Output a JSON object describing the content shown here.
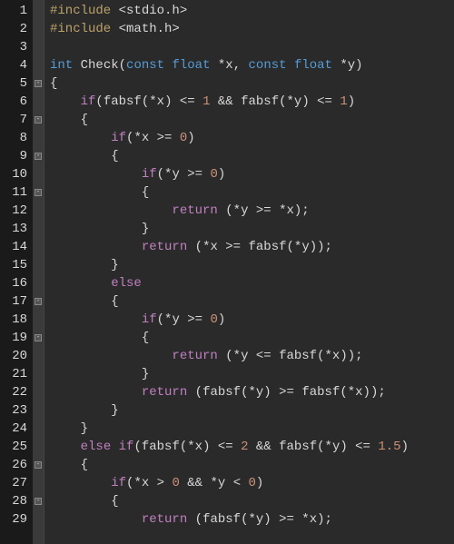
{
  "lines": [
    {
      "num": "1",
      "fold": false,
      "tokens": [
        [
          "pre",
          "#include"
        ],
        [
          "op",
          " "
        ],
        [
          "inc",
          "<stdio.h>"
        ]
      ]
    },
    {
      "num": "2",
      "fold": false,
      "tokens": [
        [
          "pre",
          "#include"
        ],
        [
          "op",
          " "
        ],
        [
          "inc",
          "<math.h>"
        ]
      ]
    },
    {
      "num": "3",
      "fold": false,
      "tokens": []
    },
    {
      "num": "4",
      "fold": false,
      "tokens": [
        [
          "kw",
          "int"
        ],
        [
          "op",
          " "
        ],
        [
          "fn",
          "Check"
        ],
        [
          "punc",
          "("
        ],
        [
          "kw",
          "const"
        ],
        [
          "op",
          " "
        ],
        [
          "kw",
          "float"
        ],
        [
          "op",
          " *"
        ],
        [
          "id",
          "x"
        ],
        [
          "punc",
          ", "
        ],
        [
          "kw",
          "const"
        ],
        [
          "op",
          " "
        ],
        [
          "kw",
          "float"
        ],
        [
          "op",
          " *"
        ],
        [
          "id",
          "y"
        ],
        [
          "punc",
          ")"
        ]
      ]
    },
    {
      "num": "5",
      "fold": true,
      "tokens": [
        [
          "punc",
          "{"
        ]
      ]
    },
    {
      "num": "6",
      "fold": false,
      "tokens": [
        [
          "op",
          "    "
        ],
        [
          "ctrl",
          "if"
        ],
        [
          "punc",
          "("
        ],
        [
          "fn",
          "fabsf"
        ],
        [
          "punc",
          "("
        ],
        [
          "op",
          "*"
        ],
        [
          "id",
          "x"
        ],
        [
          "punc",
          ")"
        ],
        [
          "op",
          " <= "
        ],
        [
          "num",
          "1"
        ],
        [
          "op",
          " && "
        ],
        [
          "fn",
          "fabsf"
        ],
        [
          "punc",
          "("
        ],
        [
          "op",
          "*"
        ],
        [
          "id",
          "y"
        ],
        [
          "punc",
          ")"
        ],
        [
          "op",
          " <= "
        ],
        [
          "num",
          "1"
        ],
        [
          "punc",
          ")"
        ]
      ]
    },
    {
      "num": "7",
      "fold": true,
      "tokens": [
        [
          "op",
          "    "
        ],
        [
          "punc",
          "{"
        ]
      ]
    },
    {
      "num": "8",
      "fold": false,
      "tokens": [
        [
          "op",
          "        "
        ],
        [
          "ctrl",
          "if"
        ],
        [
          "punc",
          "("
        ],
        [
          "op",
          "*"
        ],
        [
          "id",
          "x"
        ],
        [
          "op",
          " >= "
        ],
        [
          "num",
          "0"
        ],
        [
          "punc",
          ")"
        ]
      ]
    },
    {
      "num": "9",
      "fold": true,
      "tokens": [
        [
          "op",
          "        "
        ],
        [
          "punc",
          "{"
        ]
      ]
    },
    {
      "num": "10",
      "fold": false,
      "tokens": [
        [
          "op",
          "            "
        ],
        [
          "ctrl",
          "if"
        ],
        [
          "punc",
          "("
        ],
        [
          "op",
          "*"
        ],
        [
          "id",
          "y"
        ],
        [
          "op",
          " >= "
        ],
        [
          "num",
          "0"
        ],
        [
          "punc",
          ")"
        ]
      ]
    },
    {
      "num": "11",
      "fold": true,
      "tokens": [
        [
          "op",
          "            "
        ],
        [
          "punc",
          "{"
        ]
      ]
    },
    {
      "num": "12",
      "fold": false,
      "tokens": [
        [
          "op",
          "                "
        ],
        [
          "ctrl",
          "return"
        ],
        [
          "op",
          " "
        ],
        [
          "punc",
          "("
        ],
        [
          "op",
          "*"
        ],
        [
          "id",
          "y"
        ],
        [
          "op",
          " >= *"
        ],
        [
          "id",
          "x"
        ],
        [
          "punc",
          ");"
        ]
      ]
    },
    {
      "num": "13",
      "fold": false,
      "tokens": [
        [
          "op",
          "            "
        ],
        [
          "punc",
          "}"
        ]
      ]
    },
    {
      "num": "14",
      "fold": false,
      "tokens": [
        [
          "op",
          "            "
        ],
        [
          "ctrl",
          "return"
        ],
        [
          "op",
          " "
        ],
        [
          "punc",
          "("
        ],
        [
          "op",
          "*"
        ],
        [
          "id",
          "x"
        ],
        [
          "op",
          " >= "
        ],
        [
          "fn",
          "fabsf"
        ],
        [
          "punc",
          "("
        ],
        [
          "op",
          "*"
        ],
        [
          "id",
          "y"
        ],
        [
          "punc",
          "));"
        ]
      ]
    },
    {
      "num": "15",
      "fold": false,
      "tokens": [
        [
          "op",
          "        "
        ],
        [
          "punc",
          "}"
        ]
      ]
    },
    {
      "num": "16",
      "fold": false,
      "tokens": [
        [
          "op",
          "        "
        ],
        [
          "ctrl",
          "else"
        ]
      ]
    },
    {
      "num": "17",
      "fold": true,
      "tokens": [
        [
          "op",
          "        "
        ],
        [
          "punc",
          "{"
        ]
      ]
    },
    {
      "num": "18",
      "fold": false,
      "tokens": [
        [
          "op",
          "            "
        ],
        [
          "ctrl",
          "if"
        ],
        [
          "punc",
          "("
        ],
        [
          "op",
          "*"
        ],
        [
          "id",
          "y"
        ],
        [
          "op",
          " >= "
        ],
        [
          "num",
          "0"
        ],
        [
          "punc",
          ")"
        ]
      ]
    },
    {
      "num": "19",
      "fold": true,
      "tokens": [
        [
          "op",
          "            "
        ],
        [
          "punc",
          "{"
        ]
      ]
    },
    {
      "num": "20",
      "fold": false,
      "tokens": [
        [
          "op",
          "                "
        ],
        [
          "ctrl",
          "return"
        ],
        [
          "op",
          " "
        ],
        [
          "punc",
          "("
        ],
        [
          "op",
          "*"
        ],
        [
          "id",
          "y"
        ],
        [
          "op",
          " <= "
        ],
        [
          "fn",
          "fabsf"
        ],
        [
          "punc",
          "("
        ],
        [
          "op",
          "*"
        ],
        [
          "id",
          "x"
        ],
        [
          "punc",
          "));"
        ]
      ]
    },
    {
      "num": "21",
      "fold": false,
      "tokens": [
        [
          "op",
          "            "
        ],
        [
          "punc",
          "}"
        ]
      ]
    },
    {
      "num": "22",
      "fold": false,
      "tokens": [
        [
          "op",
          "            "
        ],
        [
          "ctrl",
          "return"
        ],
        [
          "op",
          " "
        ],
        [
          "punc",
          "("
        ],
        [
          "fn",
          "fabsf"
        ],
        [
          "punc",
          "("
        ],
        [
          "op",
          "*"
        ],
        [
          "id",
          "y"
        ],
        [
          "punc",
          ")"
        ],
        [
          "op",
          " >= "
        ],
        [
          "fn",
          "fabsf"
        ],
        [
          "punc",
          "("
        ],
        [
          "op",
          "*"
        ],
        [
          "id",
          "x"
        ],
        [
          "punc",
          "));"
        ]
      ]
    },
    {
      "num": "23",
      "fold": false,
      "tokens": [
        [
          "op",
          "        "
        ],
        [
          "punc",
          "}"
        ]
      ]
    },
    {
      "num": "24",
      "fold": false,
      "tokens": [
        [
          "op",
          "    "
        ],
        [
          "punc",
          "}"
        ]
      ]
    },
    {
      "num": "25",
      "fold": false,
      "tokens": [
        [
          "op",
          "    "
        ],
        [
          "ctrl",
          "else"
        ],
        [
          "op",
          " "
        ],
        [
          "ctrl",
          "if"
        ],
        [
          "punc",
          "("
        ],
        [
          "fn",
          "fabsf"
        ],
        [
          "punc",
          "("
        ],
        [
          "op",
          "*"
        ],
        [
          "id",
          "x"
        ],
        [
          "punc",
          ")"
        ],
        [
          "op",
          " <= "
        ],
        [
          "num",
          "2"
        ],
        [
          "op",
          " && "
        ],
        [
          "fn",
          "fabsf"
        ],
        [
          "punc",
          "("
        ],
        [
          "op",
          "*"
        ],
        [
          "id",
          "y"
        ],
        [
          "punc",
          ")"
        ],
        [
          "op",
          " <= "
        ],
        [
          "num",
          "1.5"
        ],
        [
          "punc",
          ")"
        ]
      ]
    },
    {
      "num": "26",
      "fold": true,
      "tokens": [
        [
          "op",
          "    "
        ],
        [
          "punc",
          "{"
        ]
      ]
    },
    {
      "num": "27",
      "fold": false,
      "tokens": [
        [
          "op",
          "        "
        ],
        [
          "ctrl",
          "if"
        ],
        [
          "punc",
          "("
        ],
        [
          "op",
          "*"
        ],
        [
          "id",
          "x"
        ],
        [
          "op",
          " > "
        ],
        [
          "num",
          "0"
        ],
        [
          "op",
          " && *"
        ],
        [
          "id",
          "y"
        ],
        [
          "op",
          " < "
        ],
        [
          "num",
          "0"
        ],
        [
          "punc",
          ")"
        ]
      ]
    },
    {
      "num": "28",
      "fold": true,
      "tokens": [
        [
          "op",
          "        "
        ],
        [
          "punc",
          "{"
        ]
      ]
    },
    {
      "num": "29",
      "fold": false,
      "tokens": [
        [
          "op",
          "            "
        ],
        [
          "ctrl",
          "return"
        ],
        [
          "op",
          " "
        ],
        [
          "punc",
          "("
        ],
        [
          "fn",
          "fabsf"
        ],
        [
          "punc",
          "("
        ],
        [
          "op",
          "*"
        ],
        [
          "id",
          "y"
        ],
        [
          "punc",
          ")"
        ],
        [
          "op",
          " >= *"
        ],
        [
          "id",
          "x"
        ],
        [
          "punc",
          ");"
        ]
      ]
    }
  ]
}
